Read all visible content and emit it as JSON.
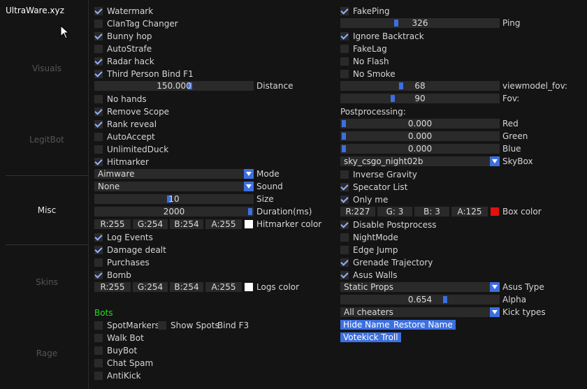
{
  "window": {
    "title": "UltraWare.xyz"
  },
  "tabs": [
    {
      "label": "Visuals",
      "active": false
    },
    {
      "label": "LegitBot",
      "active": false
    },
    {
      "label": "Misc",
      "active": true
    },
    {
      "label": "Skins",
      "active": false
    },
    {
      "label": "Rage",
      "active": false
    }
  ],
  "left": {
    "checkboxes": [
      {
        "label": "Watermark",
        "checked": true
      },
      {
        "label": "ClanTag Changer",
        "checked": false
      },
      {
        "label": "Bunny hop",
        "checked": true
      },
      {
        "label": "AutoStrafe",
        "checked": false
      },
      {
        "label": "Radar hack",
        "checked": true
      },
      {
        "label": "Third Person Bind F1",
        "checked": true
      }
    ],
    "distance": {
      "value": "150.000",
      "label": "Distance",
      "fraction": 0.6
    },
    "checkboxes2": [
      {
        "label": "No hands",
        "checked": false
      },
      {
        "label": "Remove Scope",
        "checked": true
      },
      {
        "label": "Rank reveal",
        "checked": true
      },
      {
        "label": "AutoAccept",
        "checked": false
      },
      {
        "label": "UnlimitedDuck",
        "checked": false
      },
      {
        "label": "Hitmarker",
        "checked": true
      }
    ],
    "mode": {
      "value": "Aimware",
      "label": "Mode"
    },
    "sound": {
      "value": "None",
      "label": "Sound"
    },
    "size": {
      "value": "10",
      "label": "Size",
      "fraction": 0.47
    },
    "duration": {
      "value": "2000",
      "label": "Duration(ms)",
      "fraction": 1.0
    },
    "hitmarker_color": {
      "r": "R:255",
      "g": "G:254",
      "b": "B:254",
      "a": "A:255",
      "label": "Hitmarker color",
      "swatch": "#ffffff"
    },
    "checkboxes3": [
      {
        "label": "Log Events",
        "checked": true
      },
      {
        "label": "Damage dealt",
        "checked": true
      },
      {
        "label": "Purchases",
        "checked": false
      },
      {
        "label": "Bomb",
        "checked": true
      }
    ],
    "logs_color": {
      "r": "R:255",
      "g": "G:254",
      "b": "B:254",
      "a": "A:255",
      "label": "Logs color",
      "swatch": "#ffffff"
    },
    "bots_title": "Bots",
    "spotmarkers": {
      "label": "SpotMarkers",
      "checked": false
    },
    "showspots": {
      "label": "Show Spots",
      "checked": false
    },
    "bind_f3": "Bind F3",
    "bots": [
      {
        "label": "Walk Bot",
        "checked": false
      },
      {
        "label": "BuyBot",
        "checked": false
      },
      {
        "label": "Chat Spam",
        "checked": false
      },
      {
        "label": "AntiKick",
        "checked": false
      }
    ]
  },
  "right": {
    "fakeping": {
      "label": "FakePing",
      "checked": true
    },
    "ping": {
      "value": "326",
      "label": "Ping",
      "fraction": 0.35
    },
    "checkboxes": [
      {
        "label": "Ignore Backtrack",
        "checked": true
      },
      {
        "label": "FakeLag",
        "checked": false
      },
      {
        "label": "No Flash",
        "checked": false
      },
      {
        "label": "No Smoke",
        "checked": false
      }
    ],
    "viewmodel_fov": {
      "value": "68",
      "label": "viewmodel_fov:",
      "fraction": 0.38
    },
    "fov": {
      "value": "90",
      "label": "Fov:",
      "fraction": 0.33
    },
    "postprocessing_title": "Postprocessing:",
    "red": {
      "value": "0.000",
      "label": "Red",
      "fraction": 0
    },
    "green": {
      "value": "0.000",
      "label": "Green",
      "fraction": 0
    },
    "blue": {
      "value": "0.000",
      "label": "Blue",
      "fraction": 0
    },
    "skybox": {
      "value": "sky_csgo_night02b",
      "label": "SkyBox"
    },
    "checkboxes2": [
      {
        "label": "Inverse Gravity",
        "checked": false
      },
      {
        "label": "Specator List",
        "checked": true
      },
      {
        "label": "Only me",
        "checked": true
      }
    ],
    "box_color": {
      "r": "R:227",
      "g": "G:  3",
      "b": "B:  3",
      "a": "A:125",
      "label": "Box color",
      "swatch": "#e31010"
    },
    "checkboxes3": [
      {
        "label": "Disable Postprocess",
        "checked": true
      },
      {
        "label": "NightMode",
        "checked": false
      },
      {
        "label": "Edge Jump",
        "checked": false
      },
      {
        "label": "Grenade Trajectory",
        "checked": true
      },
      {
        "label": "Asus Walls",
        "checked": true
      }
    ],
    "asus_type": {
      "value": "Static Props",
      "label": "Asus Type"
    },
    "alpha": {
      "value": "0.654",
      "label": "Alpha",
      "fraction": 0.66
    },
    "kick_types": {
      "value": "All cheaters",
      "label": "Kick types"
    },
    "buttons": {
      "hide_name": "Hide Name",
      "restore_name": "Restore Name",
      "votekick_troll": "Votekick Troll"
    }
  },
  "colors": {
    "accent": "#3d6fe0",
    "section": "#22dd22",
    "background": "#141414",
    "control": "#2a2a2a"
  }
}
